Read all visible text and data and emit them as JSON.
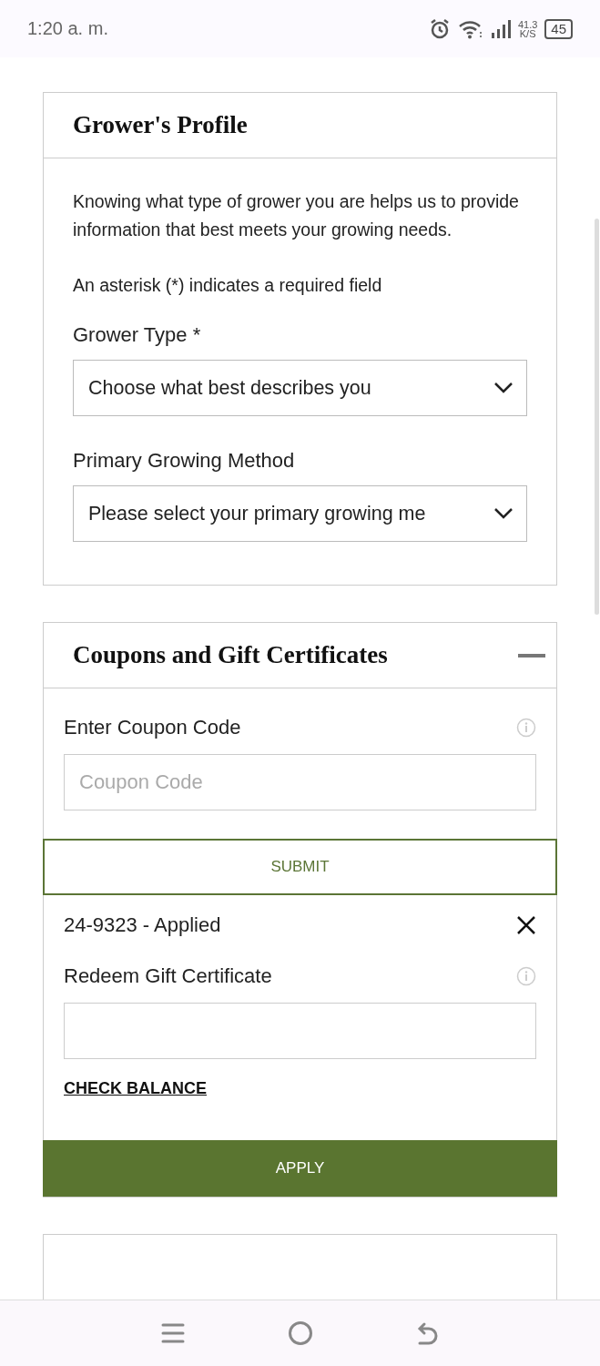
{
  "status_bar": {
    "time": "1:20 a. m.",
    "speed": "41.3",
    "speed_unit": "K/S",
    "battery": "45"
  },
  "profile": {
    "title": "Grower's Profile",
    "intro": "Knowing what type of grower you are helps us to provide information that best meets your growing needs.",
    "required_note": "An asterisk (*) indicates a required field",
    "fields": [
      {
        "label": "Grower Type *",
        "value": "Choose what best describes you"
      },
      {
        "label": "Primary Growing Method",
        "value": "Please select your primary growing me"
      }
    ]
  },
  "coupons": {
    "title": "Coupons and Gift Certificates",
    "expanded": true,
    "coupon_label": "Enter Coupon Code",
    "coupon_placeholder": "Coupon Code",
    "submit": "SUBMIT",
    "applied": "24-9323 - Applied",
    "gift_label": "Redeem Gift Certificate",
    "check_balance": "CHECK BALANCE",
    "apply": "APPLY"
  }
}
